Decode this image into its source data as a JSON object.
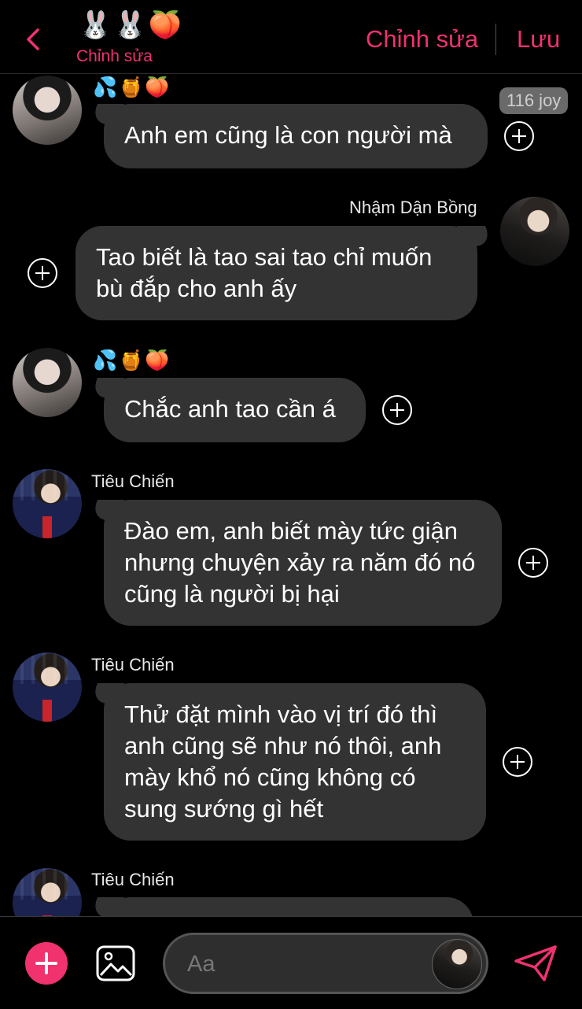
{
  "header": {
    "emojis": "🐰🐰🍑",
    "subtitle": "Chỉnh sửa",
    "edit_label": "Chỉnh sửa",
    "save_label": "Lưu"
  },
  "messages": [
    {
      "sender": "",
      "emojis": "💦🍯🍑",
      "text": "Anh em cũng là con người mà",
      "badge": "116 joy"
    },
    {
      "sender": "Nhậm Dận Bồng",
      "text": "Tao biết là tao sai tao chỉ muốn bù đắp cho anh ấy"
    },
    {
      "sender": "",
      "emojis": "💦🍯🍑",
      "text": "Chắc anh tao cần á"
    },
    {
      "sender": "Tiêu Chiến",
      "text": "Đào em, anh biết mày tức giận nhưng chuyện xảy ra năm đó nó cũng là người bị hại"
    },
    {
      "sender": "Tiêu Chiến",
      "text": "Thử đặt mình vào vị trí đó thì anh cũng sẽ như nó thôi, anh mày khổ nó cũng không có sung sướng gì hết"
    },
    {
      "sender": "Tiêu Chiến",
      "text": ""
    }
  ],
  "composer": {
    "placeholder": "Aa"
  },
  "colors": {
    "accent": "#f0326e",
    "bubble": "#333333",
    "background": "#000000"
  }
}
